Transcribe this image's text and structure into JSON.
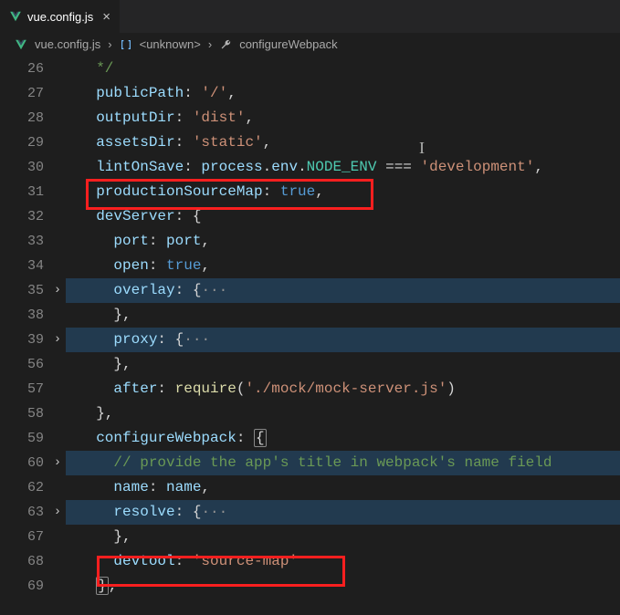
{
  "tab": {
    "filename": "vue.config.js",
    "close_glyph": "×"
  },
  "breadcrumb": {
    "file": "vue.config.js",
    "sep": "›",
    "sym1": "<unknown>",
    "sym2": "configureWebpack"
  },
  "icons": {
    "vue": "vue-logo",
    "symbol": "symbol-array",
    "wrench": "wrench"
  },
  "code": {
    "l26": {
      "num": "26",
      "cmt": "*/"
    },
    "l27": {
      "num": "27",
      "prop": "publicPath",
      "val": "'/'"
    },
    "l28": {
      "num": "28",
      "prop": "outputDir",
      "val": "'dist'"
    },
    "l29": {
      "num": "29",
      "prop": "assetsDir",
      "val": "'static'"
    },
    "l30": {
      "num": "30",
      "prop": "lintOnSave",
      "obj": "process",
      "env": "env",
      "node": "NODE_ENV",
      "op": " === ",
      "val": "'development'"
    },
    "l31": {
      "num": "31",
      "prop": "productionSourceMap",
      "val": "true"
    },
    "l32": {
      "num": "32",
      "prop": "devServer"
    },
    "l33": {
      "num": "33",
      "prop": "port",
      "val": "port"
    },
    "l34": {
      "num": "34",
      "prop": "open",
      "val": "true"
    },
    "l35": {
      "num": "35",
      "prop": "overlay",
      "dots": "···"
    },
    "l38": {
      "num": "38",
      "brace": "},"
    },
    "l39": {
      "num": "39",
      "prop": "proxy",
      "dots": "···"
    },
    "l56": {
      "num": "56",
      "brace": "},"
    },
    "l57": {
      "num": "57",
      "prop": "after",
      "func": "require",
      "arg": "'./mock/mock-server.js'"
    },
    "l58": {
      "num": "58",
      "brace": "},"
    },
    "l59": {
      "num": "59",
      "prop": "configureWebpack"
    },
    "l60": {
      "num": "60",
      "cmt": "// provide the app's title in webpack's name field"
    },
    "l62": {
      "num": "62",
      "prop": "name",
      "val": "name"
    },
    "l63": {
      "num": "63",
      "prop": "resolve",
      "dots": "···"
    },
    "l67": {
      "num": "67",
      "brace": "},"
    },
    "l68": {
      "num": "68",
      "prop": "devtool",
      "val": "'source-map'"
    },
    "l69": {
      "num": "69",
      "brace": "},"
    }
  },
  "fold_glyph": "›",
  "cursor_glyph": "I"
}
